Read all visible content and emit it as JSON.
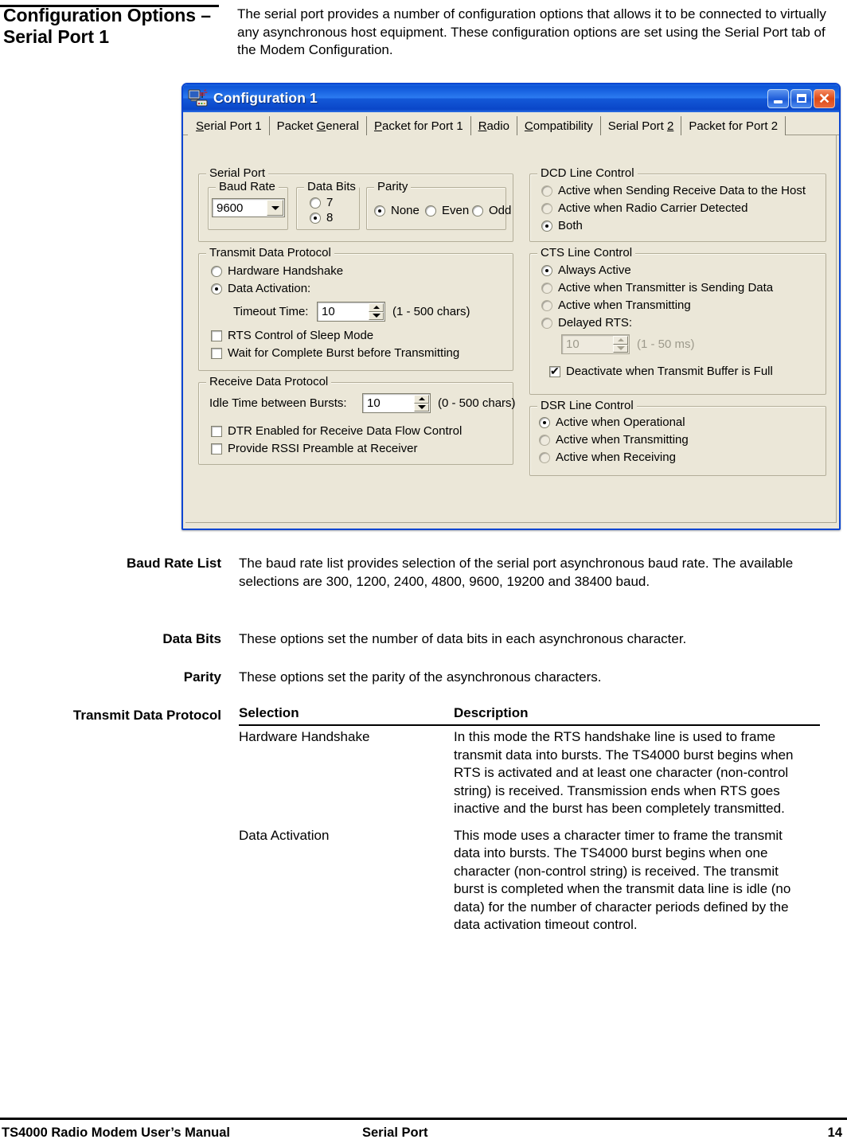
{
  "page": {
    "heading": "Configuration Options – Serial Port 1",
    "intro": "The serial port provides a number of configuration options that allows it to be connected to virtually any asynchronous host equipment.  These configuration options are set using the Serial Port tab of the Modem Configuration."
  },
  "dialog": {
    "title": "Configuration 1",
    "title_icon": "modem-computer-icon",
    "window_buttons": {
      "minimize": "–",
      "maximize": "□",
      "close": "✕"
    },
    "tabs": [
      {
        "label": "Serial Port 1",
        "accel": "S",
        "selected": true
      },
      {
        "label": "Packet General",
        "accel": "G",
        "selected": false
      },
      {
        "label": "Packet for Port 1",
        "accel": "P",
        "selected": false
      },
      {
        "label": "Radio",
        "accel": "R",
        "selected": false
      },
      {
        "label": "Compatibility",
        "accel": "C",
        "selected": false
      },
      {
        "label": "Serial Port 2",
        "accel": "2",
        "selected": false
      },
      {
        "label": "Packet for Port 2",
        "accel": "",
        "selected": false
      }
    ],
    "serial_port": {
      "legend": "Serial Port",
      "baud_rate": {
        "legend": "Baud Rate",
        "value": "9600"
      },
      "data_bits": {
        "legend": "Data Bits",
        "options": [
          {
            "label": "7",
            "checked": false
          },
          {
            "label": "8",
            "checked": true
          }
        ]
      },
      "parity": {
        "legend": "Parity",
        "options": [
          {
            "label": "None",
            "checked": true
          },
          {
            "label": "Even",
            "checked": false
          },
          {
            "label": "Odd",
            "checked": false
          }
        ]
      }
    },
    "transmit_data_protocol": {
      "legend": "Transmit Data Protocol",
      "options": [
        {
          "label": "Hardware Handshake",
          "checked": false
        },
        {
          "label": "Data Activation:",
          "checked": true
        }
      ],
      "timeout_label": "Timeout Time:",
      "timeout_value": "10",
      "timeout_range": "(1 - 500 chars)",
      "checkboxes": [
        {
          "label": "RTS Control of Sleep Mode",
          "checked": false
        },
        {
          "label": "Wait for Complete Burst before Transmitting",
          "checked": false
        }
      ]
    },
    "receive_data_protocol": {
      "legend": "Receive Data Protocol",
      "idle_label": "Idle Time between Bursts:",
      "idle_value": "10",
      "idle_range": "(0 - 500 chars)",
      "checkboxes": [
        {
          "label": "DTR Enabled for Receive Data Flow Control",
          "checked": false
        },
        {
          "label": "Provide RSSI Preamble at Receiver",
          "checked": false
        }
      ]
    },
    "dcd_line_control": {
      "legend": "DCD Line Control",
      "options": [
        {
          "label": "Active when Sending Receive Data to the Host",
          "checked": false
        },
        {
          "label": "Active when Radio Carrier Detected",
          "checked": false
        },
        {
          "label": "Both",
          "checked": true
        }
      ]
    },
    "cts_line_control": {
      "legend": "CTS Line Control",
      "options": [
        {
          "label": "Always Active",
          "checked": true
        },
        {
          "label": "Active when Transmitter is Sending Data",
          "checked": false
        },
        {
          "label": "Active when Transmitting",
          "checked": false
        },
        {
          "label": "Delayed RTS:",
          "checked": false
        }
      ],
      "delay_value": "10",
      "delay_range": "(1 - 50 ms)",
      "checkbox": {
        "label": "Deactivate when Transmit Buffer is Full",
        "checked": true
      }
    },
    "dsr_line_control": {
      "legend": "DSR Line Control",
      "options": [
        {
          "label": "Active when Operational",
          "checked": true
        },
        {
          "label": "Active when Transmitting",
          "checked": false
        },
        {
          "label": "Active when Receiving",
          "checked": false
        }
      ]
    }
  },
  "definitions": [
    {
      "term": "Baud Rate List",
      "text": "The baud rate list provides selection of the serial port asynchronous baud rate. The available selections are 300, 1200, 2400, 4800, 9600, 19200 and 38400 baud."
    },
    {
      "term": "Data Bits",
      "text": "These options set the number of data bits in each asynchronous character."
    },
    {
      "term": "Parity",
      "text": "These options set the parity of the asynchronous characters."
    }
  ],
  "table_section": {
    "term": "Transmit Data Protocol",
    "headers": [
      "Selection",
      "Description"
    ],
    "rows": [
      {
        "selection": "Hardware Handshake",
        "description": "In this mode the RTS handshake line is used to frame transmit data into bursts. The TS4000 burst begins when RTS is activated and at least one character (non-control string) is received. Transmission ends when RTS goes inactive and the burst has been completely transmitted."
      },
      {
        "selection": "Data Activation",
        "description": "This mode uses a character timer to frame the transmit data into bursts.  The TS4000 burst begins when one character (non-control string) is received. The transmit burst is completed when the transmit data line is idle (no data) for the number of character periods defined by the data activation timeout control."
      }
    ]
  },
  "footer": {
    "left": "TS4000 Radio Modem User’s Manual",
    "middle": "Serial Port",
    "right": "14"
  }
}
